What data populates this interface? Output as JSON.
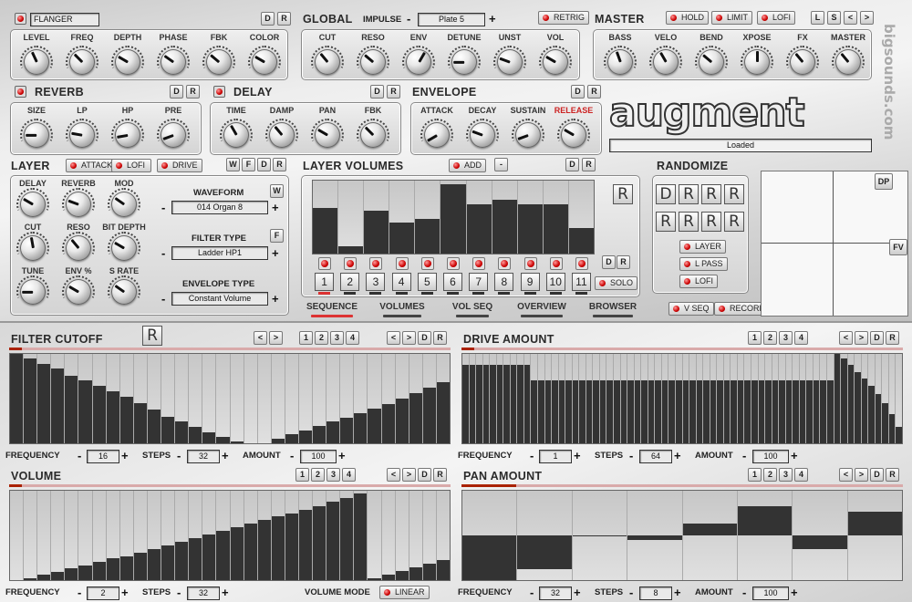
{
  "effect": {
    "name": "FLANGER",
    "knobs": [
      {
        "label": "LEVEL",
        "r": -25
      },
      {
        "label": "FREQ",
        "r": -45
      },
      {
        "label": "DEPTH",
        "r": -60
      },
      {
        "label": "PHASE",
        "r": -55
      },
      {
        "label": "FBK",
        "r": -50
      },
      {
        "label": "COLOR",
        "r": -60
      }
    ]
  },
  "global": {
    "title": "GLOBAL",
    "impulse_label": "IMPULSE",
    "impulse_value": "Plate 5",
    "retrig": "RETRIG",
    "knobs": [
      {
        "label": "CUT",
        "r": -40
      },
      {
        "label": "RESO",
        "r": -50
      },
      {
        "label": "ENV",
        "r": 30
      },
      {
        "label": "DETUNE",
        "r": -90
      },
      {
        "label": "UNST",
        "r": -70
      },
      {
        "label": "VOL",
        "r": -60
      }
    ]
  },
  "master": {
    "title": "MASTER",
    "hold": "HOLD",
    "limit": "LIMIT",
    "lofi": "LOFI",
    "buttons": [
      "L",
      "S",
      "<",
      ">"
    ],
    "knobs": [
      {
        "label": "BASS",
        "r": -20
      },
      {
        "label": "VELO",
        "r": -30
      },
      {
        "label": "BEND",
        "r": -50
      },
      {
        "label": "XPOSE",
        "r": 0
      },
      {
        "label": "FX",
        "r": -40
      },
      {
        "label": "MASTER",
        "r": -40
      }
    ]
  },
  "reverb": {
    "title": "REVERB",
    "knobs": [
      {
        "label": "SIZE",
        "r": -90
      },
      {
        "label": "LP",
        "r": -80
      },
      {
        "label": "HP",
        "r": -100
      },
      {
        "label": "PRE",
        "r": -110
      }
    ]
  },
  "delay": {
    "title": "DELAY",
    "knobs": [
      {
        "label": "TIME",
        "r": -30
      },
      {
        "label": "DAMP",
        "r": -40
      },
      {
        "label": "PAN",
        "r": -60
      },
      {
        "label": "FBK",
        "r": -45
      }
    ]
  },
  "envelope": {
    "title": "ENVELOPE",
    "knobs": [
      {
        "label": "ATTACK",
        "r": -120,
        "red": false
      },
      {
        "label": "DECAY",
        "r": -70,
        "red": false
      },
      {
        "label": "SUSTAIN",
        "r": -110,
        "red": false
      },
      {
        "label": "RELEASE",
        "r": -60,
        "red": true
      }
    ]
  },
  "logo": {
    "text": "augment",
    "status": "Loaded",
    "vendor": "bigsounds.com"
  },
  "layer": {
    "title": "LAYER",
    "attack": "ATTACK",
    "lofi": "LOFI",
    "drive": "DRIVE",
    "buttons": [
      "W",
      "F",
      "D",
      "R"
    ],
    "knobs": [
      {
        "label": "DELAY",
        "r": -60
      },
      {
        "label": "REVERB",
        "r": -70
      },
      {
        "label": "MOD",
        "r": -55
      },
      {
        "label": "CUT",
        "r": -10
      },
      {
        "label": "RESO",
        "r": -40
      },
      {
        "label": "BIT DEPTH",
        "r": -60
      },
      {
        "label": "TUNE",
        "r": -90
      },
      {
        "label": "ENV %",
        "r": -60
      },
      {
        "label": "S RATE",
        "r": -55
      }
    ],
    "waveform_label": "WAVEFORM",
    "waveform_value": "014 Organ 8",
    "w_btn": "W",
    "filter_label": "FILTER TYPE",
    "filter_value": "Ladder HP1",
    "f_btn": "F",
    "envtype_label": "ENVELOPE TYPE",
    "envtype_value": "Constant Volume"
  },
  "layer_volumes": {
    "title": "LAYER VOLUMES",
    "add": "ADD",
    "minus": "-",
    "buttons": [
      "D",
      "R"
    ],
    "r_btn": "R",
    "solo": "SOLO",
    "row_buttons": [
      "D",
      "R"
    ],
    "values": [
      0.62,
      0.1,
      0.59,
      0.43,
      0.47,
      0.95,
      0.67,
      0.74,
      0.67,
      0.67,
      0.35
    ],
    "numbers": [
      "1",
      "2",
      "3",
      "4",
      "5",
      "6",
      "7",
      "8",
      "9",
      "10",
      "11"
    ]
  },
  "tabs": [
    {
      "label": "SEQUENCE",
      "active": true
    },
    {
      "label": "VOLUMES",
      "active": false
    },
    {
      "label": "VOL SEQ",
      "active": false
    },
    {
      "label": "OVERVIEW",
      "active": false
    },
    {
      "label": "BROWSER",
      "active": false
    }
  ],
  "randomize": {
    "title": "RANDOMIZE",
    "r_cells": [
      "D",
      "R",
      "R",
      "R",
      "R",
      "R",
      "R",
      "R"
    ],
    "layer": "LAYER",
    "lpass": "L PASS",
    "lofi": "LOFI",
    "vseq": "V SEQ",
    "record": "RECORD",
    "dp": "DP",
    "fv": "FV"
  },
  "seq": {
    "filter": {
      "title": "FILTER CUTOFF",
      "r_btn": "R",
      "nums": [
        "1",
        "2",
        "3",
        "4"
      ],
      "nav": [
        "<",
        ">",
        "D",
        "R"
      ],
      "pre_nav": [
        "<",
        ">"
      ],
      "freq_label": "FREQUENCY",
      "freq": "16",
      "steps_label": "STEPS",
      "steps": "32",
      "amount_label": "AMOUNT",
      "amount": "100",
      "values": [
        1.0,
        0.95,
        0.89,
        0.84,
        0.76,
        0.7,
        0.64,
        0.58,
        0.52,
        0.45,
        0.38,
        0.3,
        0.24,
        0.18,
        0.12,
        0.07,
        0.02,
        0,
        0,
        0.05,
        0.1,
        0.14,
        0.19,
        0.24,
        0.29,
        0.34,
        0.39,
        0.44,
        0.5,
        0.56,
        0.62,
        0.68
      ]
    },
    "drive": {
      "title": "DRIVE AMOUNT",
      "nums": [
        "1",
        "2",
        "3",
        "4"
      ],
      "nav": [
        "<",
        ">",
        "D",
        "R"
      ],
      "freq_label": "FREQUENCY",
      "freq": "1",
      "steps_label": "STEPS",
      "steps": "64",
      "amount_label": "AMOUNT",
      "amount": "100",
      "values": [
        0.88,
        0.88,
        0.88,
        0.88,
        0.88,
        0.88,
        0.88,
        0.88,
        0.88,
        0.88,
        0.7,
        0.7,
        0.7,
        0.7,
        0.7,
        0.7,
        0.7,
        0.7,
        0.7,
        0.7,
        0.7,
        0.7,
        0.7,
        0.7,
        0.7,
        0.7,
        0.7,
        0.7,
        0.7,
        0.7,
        0.7,
        0.7,
        0.7,
        0.7,
        0.7,
        0.7,
        0.7,
        0.7,
        0.7,
        0.7,
        0.7,
        0.7,
        0.7,
        0.7,
        0.7,
        0.7,
        0.7,
        0.7,
        0.7,
        0.7,
        0.7,
        0.7,
        0.7,
        0.7,
        1.0,
        0.95,
        0.88,
        0.8,
        0.72,
        0.64,
        0.55,
        0.45,
        0.33,
        0.18
      ]
    },
    "volume": {
      "title": "VOLUME",
      "nums": [
        "1",
        "2",
        "3",
        "4"
      ],
      "nav": [
        "<",
        ">",
        "D",
        "R"
      ],
      "freq_label": "FREQUENCY",
      "freq": "2",
      "steps_label": "STEPS",
      "steps": "32",
      "mode_label": "VOLUME MODE",
      "mode": "LINEAR",
      "values": [
        0,
        0.02,
        0.06,
        0.09,
        0.13,
        0.16,
        0.2,
        0.24,
        0.27,
        0.31,
        0.35,
        0.39,
        0.43,
        0.47,
        0.51,
        0.55,
        0.59,
        0.63,
        0.67,
        0.71,
        0.75,
        0.79,
        0.83,
        0.88,
        0.92,
        0.97,
        0.02,
        0.06,
        0.1,
        0.14,
        0.18,
        0.22
      ]
    },
    "pan": {
      "title": "PAN AMOUNT",
      "nums": [
        "1",
        "2",
        "3",
        "4"
      ],
      "nav": [
        "<",
        ">",
        "D",
        "R"
      ],
      "freq_label": "FREQUENCY",
      "freq": "32",
      "steps_label": "STEPS",
      "steps": "8",
      "amount_label": "AMOUNT",
      "amount": "100",
      "values": [
        -0.5,
        -0.38,
        0,
        -0.05,
        0.13,
        0.33,
        -0.15,
        0.27
      ]
    }
  }
}
